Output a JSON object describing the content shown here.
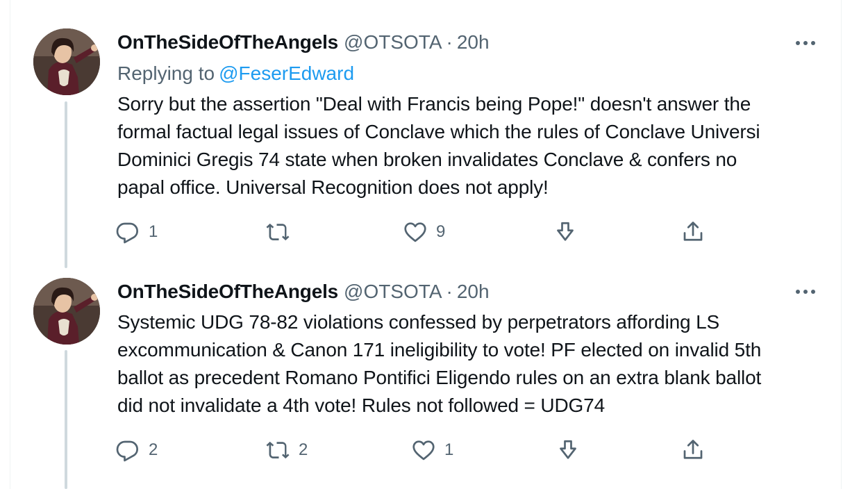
{
  "tweets": [
    {
      "name": "OnTheSideOfTheAngels",
      "handle": "@OTSOTA",
      "separator": "·",
      "time": "20h",
      "replying_prefix": "Replying to",
      "replying_to": "@FeserEdward",
      "text_lines": [
        "Sorry but the assertion \"Deal with Francis being Pope!\" doesn't answer the",
        "formal factual legal issues of Conclave which the rules of Conclave Universi",
        "Dominici Gregis 74 state when broken invalidates Conclave & confers no",
        "papal office. Universal Recognition does not apply!"
      ],
      "replies": "1",
      "retweets": "",
      "likes": "9"
    },
    {
      "name": "OnTheSideOfTheAngels",
      "handle": "@OTSOTA",
      "separator": "·",
      "time": "20h",
      "text_lines": [
        "Systemic UDG 78-82 violations confessed by perpetrators affording LS",
        "excommunication & Canon 171 ineligibility to vote! PF elected on invalid 5th",
        "ballot as precedent Romano Pontifici Eligendo rules on an extra blank ballot",
        "did not invalidate a 4th vote! Rules not followed = UDG74"
      ],
      "replies": "2",
      "retweets": "2",
      "likes": "1"
    }
  ],
  "icons": {
    "reply": "reply-icon",
    "retweet": "retweet-icon",
    "like": "heart-icon",
    "bookmark": "bookmark-download-icon",
    "share": "share-icon",
    "more": "more-options-icon"
  },
  "colors": {
    "text": "#0f1419",
    "secondary": "#536471",
    "link": "#1d9bf0",
    "thread_line": "#cfd9de",
    "border": "#eff3f4"
  }
}
